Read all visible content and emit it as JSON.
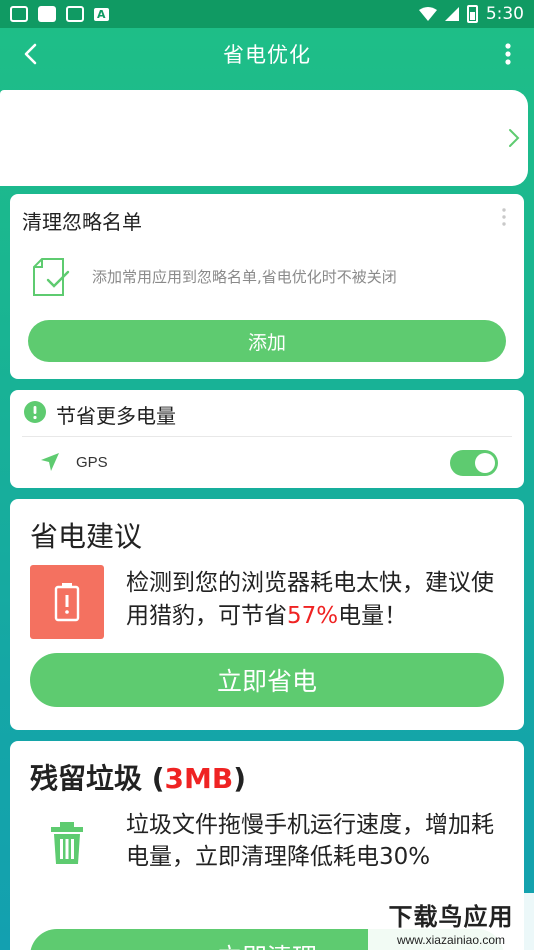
{
  "status_bar": {
    "time": "5:30",
    "letter": "A"
  },
  "header": {
    "title": "省电优化"
  },
  "ignore_card": {
    "title": "清理忽略名单",
    "description": "添加常用应用到忽略名单,省电优化时不被关闭",
    "add_label": "添加"
  },
  "save_more": {
    "title": "节省更多电量",
    "gps_label": "GPS",
    "gps_enabled": true
  },
  "advice": {
    "title": "省电建议",
    "text_before": "检测到您的浏览器耗电太快，建议使用猎豹，可节省",
    "percent": "57%",
    "text_after": "电量！",
    "button_label": "立即省电"
  },
  "junk": {
    "title_prefix": "残留垃圾 (",
    "size": "3MB",
    "title_suffix": ")",
    "text": "垃圾文件拖慢手机运行速度，增加耗电量，立即清理降低耗电30%",
    "button_label": "立即清理"
  },
  "watermark": {
    "main": "下载鸟应用",
    "sub": "www.xiazainiao.com"
  },
  "colors": {
    "green": "#5ecb70",
    "red": "#ef2323",
    "tile": "#f47160",
    "status": "#109a63"
  }
}
